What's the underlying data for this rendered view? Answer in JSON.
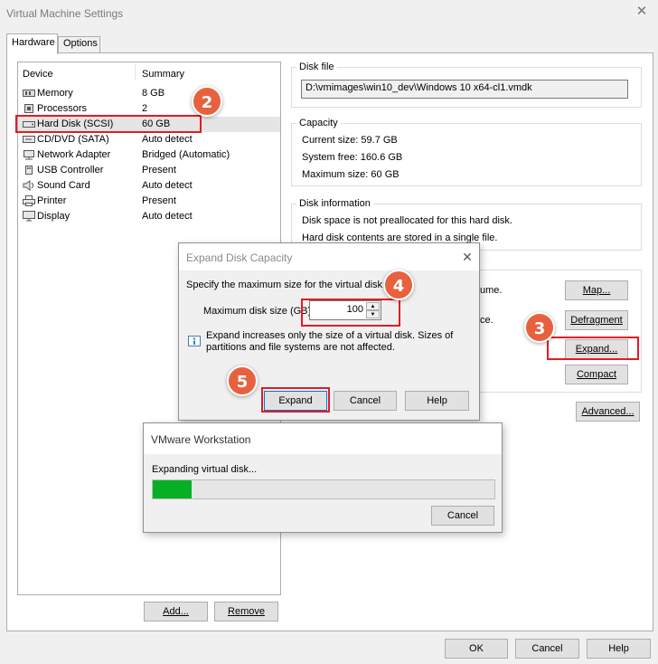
{
  "window": {
    "title": "Virtual Machine Settings",
    "close_glyph": "✕"
  },
  "tabs": [
    {
      "label": "Hardware",
      "active": true
    },
    {
      "label": "Options",
      "active": false
    }
  ],
  "device_list": {
    "col_device": "Device",
    "col_summary": "Summary",
    "rows": [
      {
        "icon": "memory-icon",
        "name": "Memory",
        "summary": "8 GB"
      },
      {
        "icon": "processor-icon",
        "name": "Processors",
        "summary": "2"
      },
      {
        "icon": "hard-disk-icon",
        "name": "Hard Disk (SCSI)",
        "summary": "60 GB",
        "selected": true
      },
      {
        "icon": "cd-dvd-icon",
        "name": "CD/DVD (SATA)",
        "summary": "Auto detect"
      },
      {
        "icon": "network-adapter-icon",
        "name": "Network Adapter",
        "summary": "Bridged (Automatic)"
      },
      {
        "icon": "usb-icon",
        "name": "USB Controller",
        "summary": "Present"
      },
      {
        "icon": "sound-card-icon",
        "name": "Sound Card",
        "summary": "Auto detect"
      },
      {
        "icon": "printer-icon",
        "name": "Printer",
        "summary": "Present"
      },
      {
        "icon": "display-icon",
        "name": "Display",
        "summary": "Auto detect"
      }
    ],
    "add_button": "Add...",
    "remove_button": "Remove"
  },
  "disk_file": {
    "label": "Disk file",
    "path": "D:\\vmimages\\win10_dev\\Windows 10 x64-cl1.vmdk"
  },
  "capacity": {
    "label": "Capacity",
    "current_size": "Current size:  59.7 GB",
    "system_free": "System free:  160.6 GB",
    "maximum_size": "Maximum size:  60 GB"
  },
  "disk_info": {
    "label": "Disk information",
    "line1": "Disk space is not preallocated for this hard disk.",
    "line2": "Hard disk contents are stored in a single file."
  },
  "utilities": {
    "map_text_tail": "ume.",
    "defrag_text_tail": "ce.",
    "map_button": "Map...",
    "defragment_button": "Defragment",
    "expand_button": "Expand...",
    "compact_button": "Compact",
    "advanced_button": "Advanced..."
  },
  "expand_dialog": {
    "title": "Expand Disk Capacity",
    "prompt": "Specify the maximum size for the virtual disk:",
    "size_label": "Maximum disk size (GB)",
    "size_value": "100",
    "info_line1": "Expand increases only the size of a virtual disk. Sizes of",
    "info_line2": "partitions and file systems are not affected.",
    "expand_button": "Expand",
    "cancel_button": "Cancel",
    "help_button": "Help"
  },
  "progress_dialog": {
    "title": "VMware Workstation",
    "message": "Expanding virtual disk...",
    "progress": 0.05,
    "cancel_button": "Cancel"
  },
  "footer": {
    "ok_button": "OK",
    "cancel_button": "Cancel",
    "help_button": "Help"
  },
  "callouts": {
    "two": "2",
    "three": "3",
    "four": "4",
    "five": "5"
  },
  "colors": {
    "accent_red": "#e31b23",
    "badge": "#e8613f",
    "progress_green": "#06b025"
  }
}
